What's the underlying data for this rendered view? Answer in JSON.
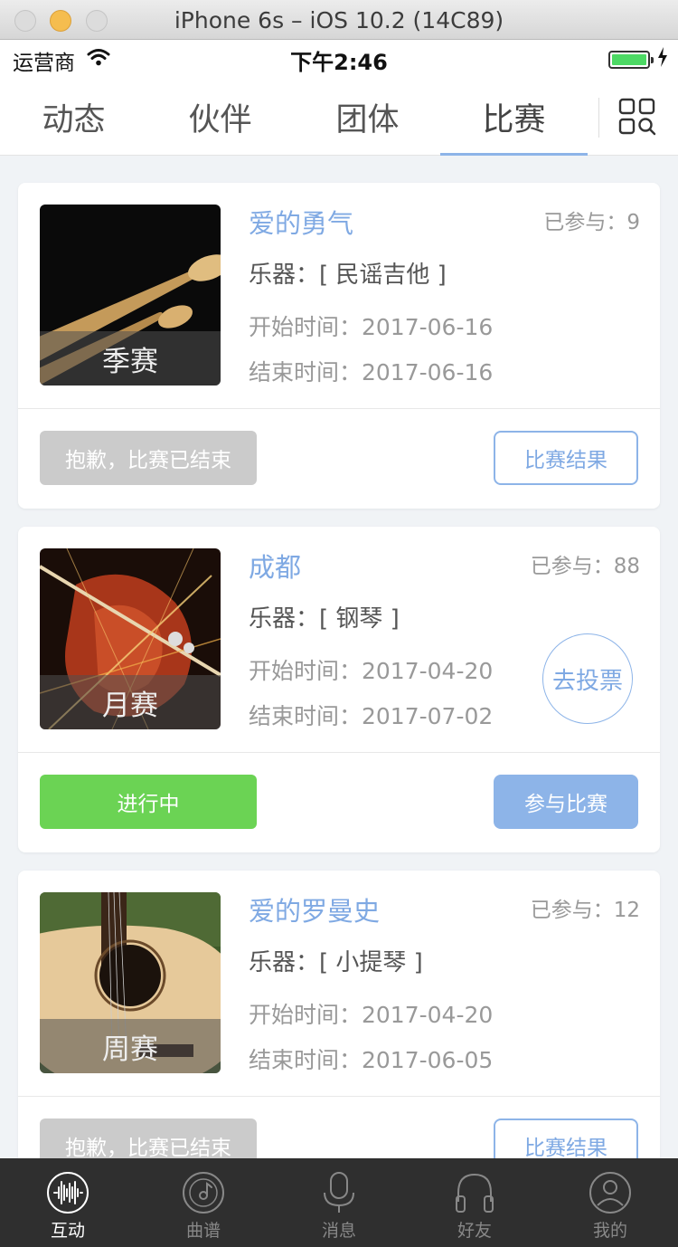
{
  "window": {
    "title": "iPhone 6s – iOS 10.2 (14C89)"
  },
  "status_bar": {
    "carrier": "运营商",
    "time": "下午2:46"
  },
  "tabs": [
    {
      "label": "动态"
    },
    {
      "label": "伙伴"
    },
    {
      "label": "团体"
    },
    {
      "label": "比赛"
    }
  ],
  "active_tab": "比赛",
  "accent_color": "#8db4e8",
  "competitions": [
    {
      "image_label": "季赛",
      "title": "爱的勇气",
      "participants": "已参与：9",
      "instrument": "乐器：[ 民谣吉他 ]",
      "start": "开始时间：2017-06-16",
      "end": "结束时间：2017-06-16",
      "status": "抱歉，比赛已结束",
      "action": "比赛结果"
    },
    {
      "image_label": "月赛",
      "title": "成都",
      "participants": "已参与：88",
      "instrument": "乐器：[ 钢琴 ]",
      "start": "开始时间：2017-04-20",
      "end": "结束时间：2017-07-02",
      "vote": "去投票",
      "status": "进行中",
      "action": "参与比赛"
    },
    {
      "image_label": "周赛",
      "title": "爱的罗曼史",
      "participants": "已参与：12",
      "instrument": "乐器：[ 小提琴 ]",
      "start": "开始时间：2017-04-20",
      "end": "结束时间：2017-06-05",
      "status": "抱歉，比赛已结束",
      "action": "比赛结果"
    }
  ],
  "bottom_nav": [
    {
      "label": "互动",
      "icon": "waveform-icon"
    },
    {
      "label": "曲谱",
      "icon": "disc-icon"
    },
    {
      "label": "消息",
      "icon": "microphone-icon"
    },
    {
      "label": "好友",
      "icon": "headphones-icon"
    },
    {
      "label": "我的",
      "icon": "user-icon"
    }
  ],
  "bottom_nav_active": "互动"
}
